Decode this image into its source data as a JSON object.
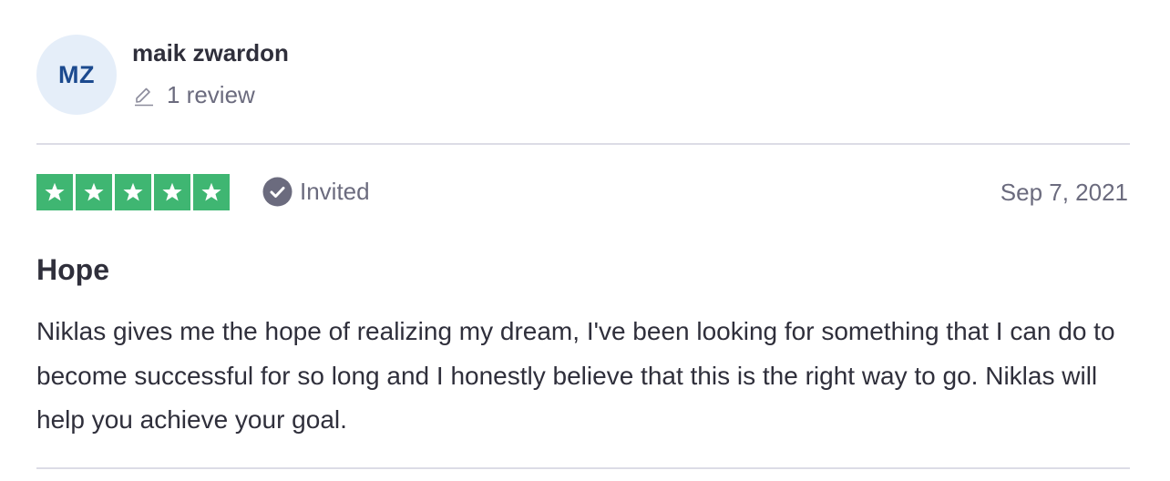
{
  "reviewer": {
    "initials": "MZ",
    "name": "maik zwardon",
    "review_count": "1 review",
    "avatar_bg": "#e5eef9",
    "avatar_text_color": "#1c4a8f"
  },
  "review": {
    "rating": 5,
    "rating_max": 5,
    "star_color": "#3fb672",
    "status_label": "Invited",
    "status_icon": "check-circle-icon",
    "date": "Sep 7, 2021",
    "title": "Hope",
    "body": "Niklas gives me the hope of realizing my dream, I've been looking for something that I can do to become successful for so long and I honestly believe that this is the right way to go. Niklas will help you achieve your goal."
  }
}
